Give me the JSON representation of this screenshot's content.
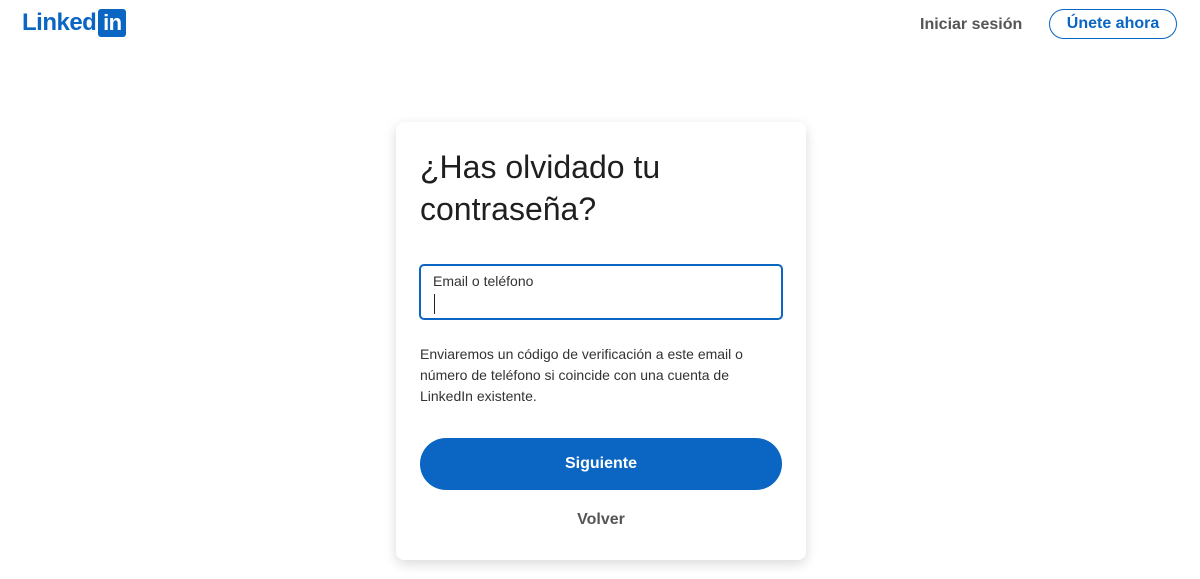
{
  "header": {
    "logo": {
      "word": "Linked",
      "box": "in"
    },
    "signin_label": "Iniciar sesión",
    "join_label": "Únete ahora"
  },
  "card": {
    "title": "¿Has olvidado tu contraseña?",
    "field": {
      "label": "Email o teléfono",
      "value": ""
    },
    "helper_text": "Enviaremos un código de verificación a este email o número de teléfono si coincide con una cuenta de LinkedIn existente.",
    "next_label": "Siguiente",
    "back_label": "Volver"
  },
  "colors": {
    "brand": "#0a66c2",
    "muted_text": "#555555",
    "text": "#1f1f1f"
  }
}
